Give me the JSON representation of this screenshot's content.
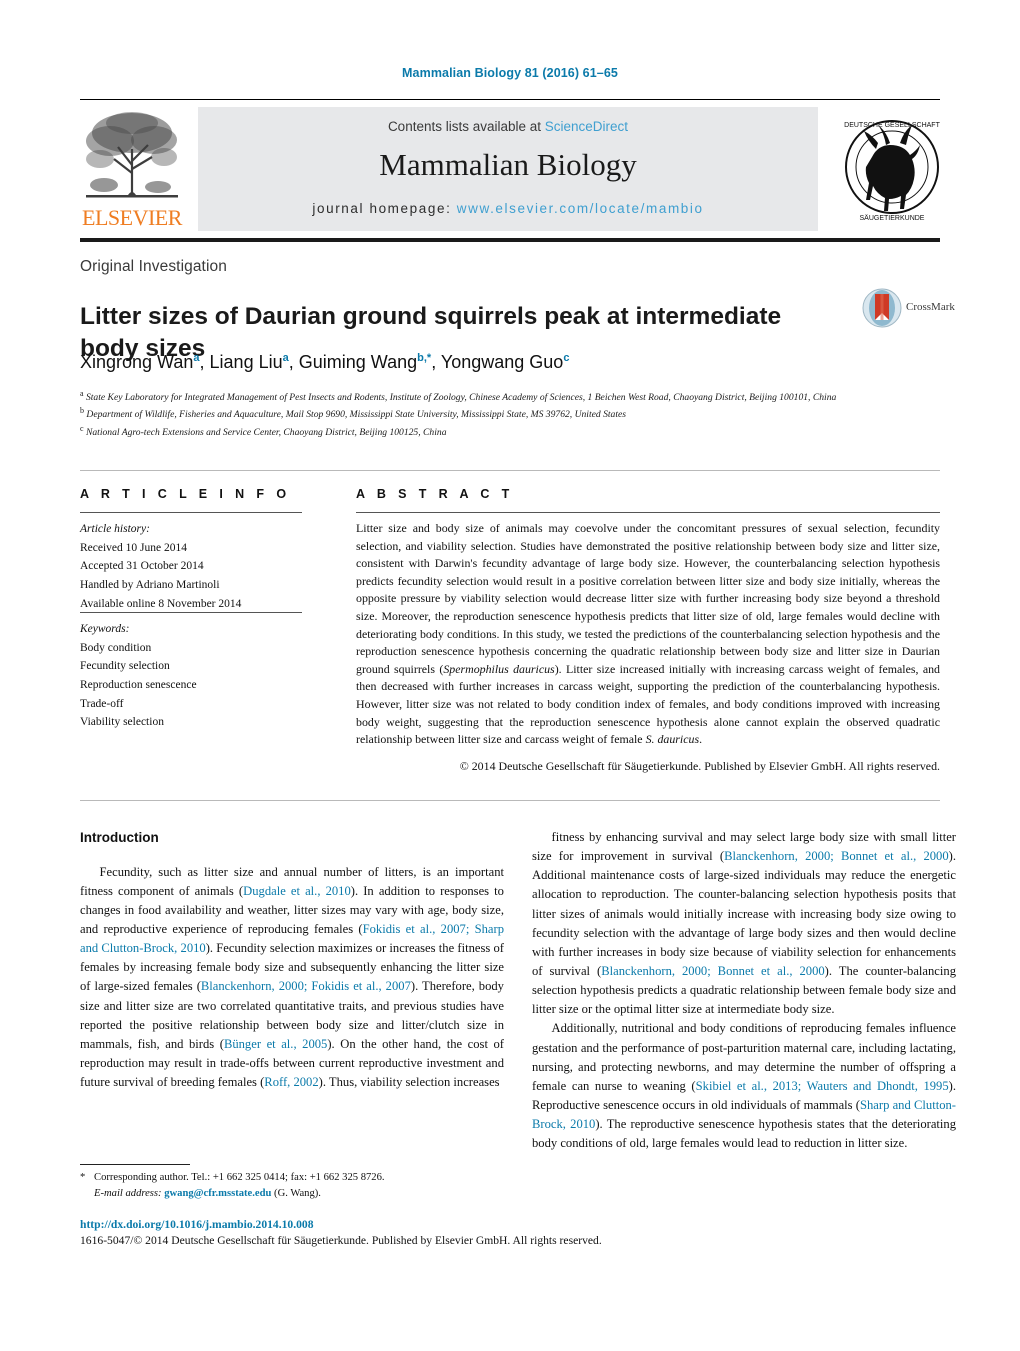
{
  "running_head": "Mammalian Biology 81 (2016) 61–65",
  "masthead": {
    "contents_prefix": "Contents lists available at ",
    "contents_link": "ScienceDirect",
    "journal_title": "Mammalian Biology",
    "homepage_prefix": "journal homepage: ",
    "homepage_url": "www.elsevier.com/locate/mambio",
    "publisher_wordmark": "ELSEVIER",
    "society_logo_text": "DEUTSCHE GESELLSCHAFT FÜR SÄUGETIERKUNDE E.V."
  },
  "article": {
    "category": "Original Investigation",
    "title": "Litter sizes of Daurian ground squirrels peak at intermediate body sizes",
    "crossmark_label": "CrossMark",
    "authors_html": "Xingrong Wan<sup>a</sup>, Liang Liu<sup>a</sup>, Guiming Wang<sup>b,*</sup>, Yongwang Guo<sup>c</sup>",
    "affiliations": [
      {
        "marker": "a",
        "text": "State Key Laboratory for Integrated Management of Pest Insects and Rodents, Institute of Zoology, Chinese Academy of Sciences, 1 Beichen West Road, Chaoyang District, Beijing 100101, China"
      },
      {
        "marker": "b",
        "text": "Department of Wildlife, Fisheries and Aquaculture, Mail Stop 9690, Mississippi State University, Mississippi State, MS 39762, United States"
      },
      {
        "marker": "c",
        "text": "National Agro-tech Extensions and Service Center, Chaoyang District, Beijing 100125, China"
      }
    ]
  },
  "article_info": {
    "heading": "A R T I C L E  I N F O",
    "history_label": "Article history:",
    "history": [
      "Received 10 June 2014",
      "Accepted 31 October 2014",
      "Handled by Adriano Martinoli",
      "Available online 8 November 2014"
    ],
    "keywords_label": "Keywords:",
    "keywords": [
      "Body condition",
      "Fecundity selection",
      "Reproduction senescence",
      "Trade-off",
      "Viability selection"
    ]
  },
  "abstract": {
    "heading": "A B S T R A C T",
    "body": "Litter size and body size of animals may coevolve under the concomitant pressures of sexual selection, fecundity selection, and viability selection. Studies have demonstrated the positive relationship between body size and litter size, consistent with Darwin's fecundity advantage of large body size. However, the counterbalancing selection hypothesis predicts fecundity selection would result in a positive correlation between litter size and body size initially, whereas the opposite pressure by viability selection would decrease litter size with further increasing body size beyond a threshold size. Moreover, the reproduction senescence hypothesis predicts that litter size of old, large females would decline with deteriorating body conditions. In this study, we tested the predictions of the counterbalancing selection hypothesis and the reproduction senescence hypothesis concerning the quadratic relationship between body size and litter size in Daurian ground squirrels (Spermophilus dauricus). Litter size increased initially with increasing carcass weight of females, and then decreased with further increases in carcass weight, supporting the prediction of the counterbalancing hypothesis. However, litter size was not related to body condition index of females, and body conditions improved with increasing body weight, suggesting that the reproduction senescence hypothesis alone cannot explain the observed quadratic relationship between litter size and carcass weight of female S. dauricus.",
    "species_italic": "Spermophilus dauricus",
    "species_short_italic": "S. dauricus",
    "copyright": "© 2014 Deutsche Gesellschaft für Säugetierkunde. Published by Elsevier GmbH. All rights reserved."
  },
  "introduction": {
    "heading": "Introduction",
    "left_paragraph": "Fecundity, such as litter size and annual number of litters, is an important fitness component of animals (Dugdale et al., 2010). In addition to responses to changes in food availability and weather, litter sizes may vary with age, body size, and reproductive experience of reproducing females (Fokidis et al., 2007; Sharp and Clutton-Brock, 2010). Fecundity selection maximizes or increases the fitness of females by increasing female body size and subsequently enhancing the litter size of large-sized females (Blanckenhorn, 2000; Fokidis et al., 2007). Therefore, body size and litter size are two correlated quantitative traits, and previous studies have reported the positive relationship between body size and litter/clutch size in mammals, fish, and birds (Bünger et al., 2005). On the other hand, the cost of reproduction may result in trade-offs between current reproductive investment and future survival of breeding females (Roff, 2002). Thus, viability selection increases",
    "right_paragraph_1": "fitness by enhancing survival and may select large body size with small litter size for improvement in survival (Blanckenhorn, 2000; Bonnet et al., 2000). Additional maintenance costs of large-sized individuals may reduce the energetic allocation to reproduction. The counter-balancing selection hypothesis posits that litter sizes of animals would initially increase with increasing body size owing to fecundity selection with the advantage of large body sizes and then would decline with further increases in body size because of viability selection for enhancements of survival (Blanckenhorn, 2000; Bonnet et al., 2000). The counter-balancing selection hypothesis predicts a quadratic relationship between female body size and litter size or the optimal litter size at intermediate body size.",
    "right_paragraph_2": "Additionally, nutritional and body conditions of reproducing females influence gestation and the performance of post-parturition maternal care, including lactating, nursing, and protecting newborns, and may determine the number of offspring a female can nurse to weaning (Skibiel et al., 2013; Wauters and Dhondt, 1995). Reproductive senescence occurs in old individuals of mammals (Sharp and Clutton-Brock, 2010). The reproductive senescence hypothesis states that the deteriorating body conditions of old, large females would lead to reduction in litter size."
  },
  "footnote": {
    "star": "*",
    "corresponding": "Corresponding author. Tel.: +1 662 325 0414; fax: +1 662 325 8726.",
    "email_label": "E-mail address:",
    "email": "gwang@cfr.msstate.edu",
    "email_suffix": "(G. Wang)."
  },
  "footer": {
    "doi": "http://dx.doi.org/10.1016/j.mambio.2014.10.008",
    "issn_line": "1616-5047/© 2014 Deutsche Gesellschaft für Säugetierkunde. Published by Elsevier GmbH. All rights reserved."
  },
  "colors": {
    "link_blue": "#0b7aaa",
    "elsevier_orange": "#ef7d22",
    "band_gray": "#e7e8ea",
    "sciencedirect_blue": "#3f9fd0"
  }
}
